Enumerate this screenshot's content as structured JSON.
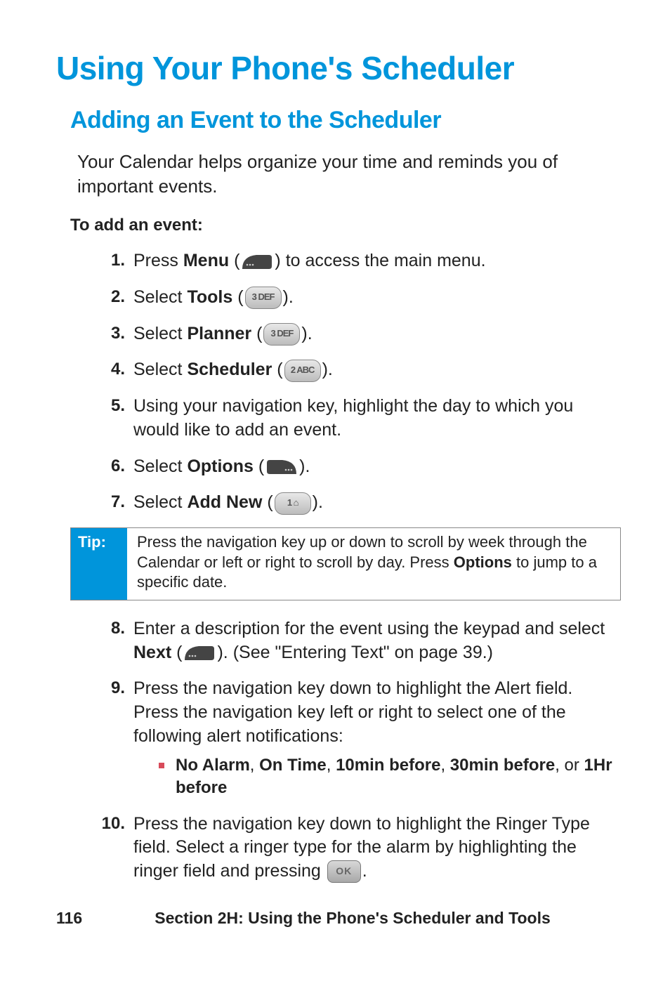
{
  "title": "Using Your Phone's Scheduler",
  "subtitle": "Adding an Event to the Scheduler",
  "intro": "Your Calendar helps organize your time and reminds you of important events.",
  "subhead": "To add an event:",
  "steps": {
    "s1": {
      "num": "1",
      "pre": "Press ",
      "bold": "Menu",
      "post": " to access the main menu."
    },
    "s2": {
      "num": "2",
      "pre": "Select ",
      "bold": "Tools"
    },
    "s3": {
      "num": "3",
      "pre": "Select ",
      "bold": "Planner"
    },
    "s4": {
      "num": "4",
      "pre": "Select ",
      "bold": "Scheduler"
    },
    "s5": {
      "num": "5",
      "text": "Using your navigation key, highlight the day to which you would like to add an event."
    },
    "s6": {
      "num": "6",
      "pre": "Select ",
      "bold": "Options"
    },
    "s7": {
      "num": "7",
      "pre": "Select ",
      "bold": "Add New"
    },
    "s8": {
      "num": "8",
      "pre": "Enter a description for the event using the keypad and select ",
      "bold": "Next",
      "post": ". (See \"Entering Text\" on page 39.)"
    },
    "s9": {
      "num": "9",
      "text": "Press the navigation key down to highlight the Alert field. Press the navigation key left or right to select one of the following alert notifications:",
      "bullet": {
        "b1": "No Alarm",
        "b2": "On Time",
        "b3": "10min before",
        "b4": "30min before",
        "tail": ", or ",
        "b5": "1Hr before"
      }
    },
    "s10": {
      "num": "10",
      "pre": "Press the navigation key down to highlight the Ringer Type field. Select a ringer type for the alarm by highlighting the ringer field and pressing ",
      "post": "."
    }
  },
  "keys": {
    "k3": "3 DEF",
    "k2": "2 ABC",
    "k1": "1 ⌂",
    "ok": "OK"
  },
  "tip": {
    "label": "Tip:",
    "body_pre": "Press the navigation key up or down to scroll by week through the Calendar or left or right to scroll by day. Press ",
    "body_bold": "Options",
    "body_post": " to jump to a specific date."
  },
  "footer": {
    "page": "116",
    "text": "Section 2H: Using the Phone's Scheduler and Tools"
  }
}
